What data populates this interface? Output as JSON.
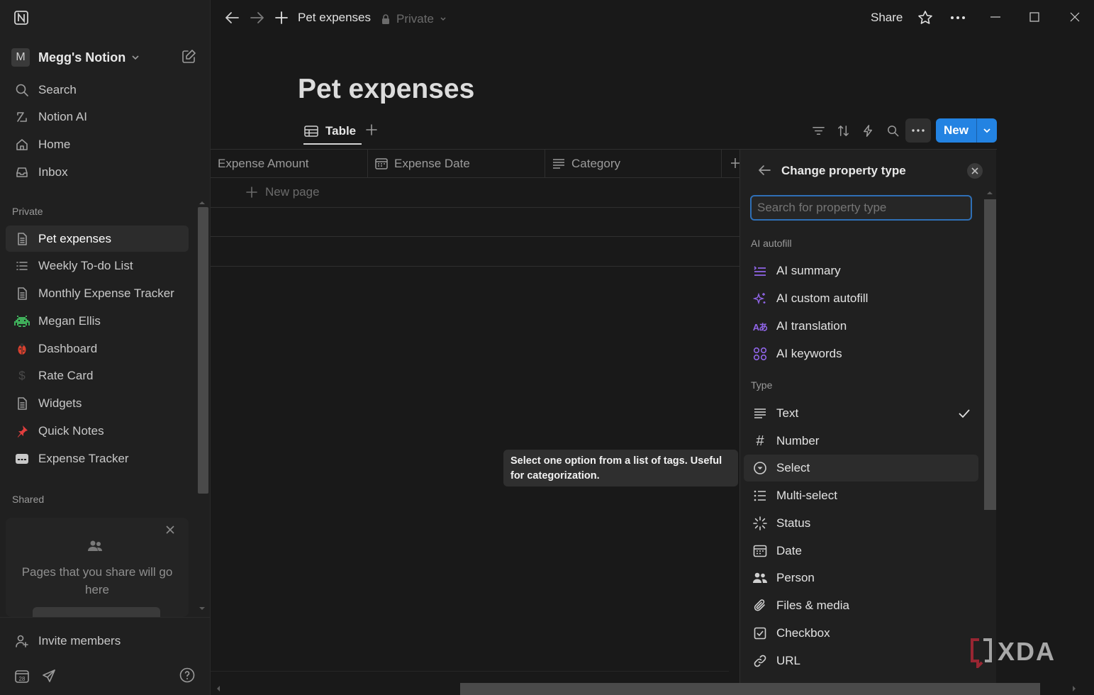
{
  "topbar": {
    "page_title": "Pet expenses",
    "privacy": "Private",
    "share": "Share"
  },
  "sidebar": {
    "workspace_initial": "M",
    "workspace_name": "Megg's Notion",
    "nav": [
      {
        "label": "Search",
        "icon": "search-icon"
      },
      {
        "label": "Notion AI",
        "icon": "notion-ai-icon"
      },
      {
        "label": "Home",
        "icon": "home-icon"
      },
      {
        "label": "Inbox",
        "icon": "inbox-icon"
      }
    ],
    "private_label": "Private",
    "pages": [
      {
        "label": "Pet expenses",
        "icon": "page-icon"
      },
      {
        "label": "Weekly To-do List",
        "icon": "list-icon"
      },
      {
        "label": "Monthly Expense Tracker",
        "icon": "page-icon"
      },
      {
        "label": "Megan Ellis",
        "icon": "space-invader-icon"
      },
      {
        "label": "Dashboard",
        "icon": "beetle-icon"
      },
      {
        "label": "Rate Card",
        "icon": "dollar-icon"
      },
      {
        "label": "Widgets",
        "icon": "page-icon"
      },
      {
        "label": "Quick Notes",
        "icon": "pin-icon"
      },
      {
        "label": "Expense Tracker",
        "icon": "card-icon"
      }
    ],
    "shared_label": "Shared",
    "shared_empty_text": "Pages that you share will go here",
    "invite_members": "Invite members"
  },
  "page": {
    "title": "Pet expenses",
    "view_tab": "Table",
    "new_button": "New"
  },
  "table": {
    "columns": [
      {
        "label": "Expense Amount"
      },
      {
        "label": "Expense Date"
      },
      {
        "label": "Category"
      }
    ],
    "new_page": "New page"
  },
  "tooltip": {
    "text": "Select one option from a list of tags. Useful for categorization."
  },
  "panel": {
    "title": "Change property type",
    "search_placeholder": "Search for property type",
    "ai_label": "AI autofill",
    "ai_options": [
      {
        "label": "AI summary",
        "icon": "ai-summary-icon"
      },
      {
        "label": "AI custom autofill",
        "icon": "sparkle-icon"
      },
      {
        "label": "AI translation",
        "icon": "translate-icon"
      },
      {
        "label": "AI keywords",
        "icon": "keywords-icon"
      }
    ],
    "type_label": "Type",
    "type_options": [
      {
        "label": "Text",
        "icon": "text-icon",
        "selected": true
      },
      {
        "label": "Number",
        "icon": "hash-icon"
      },
      {
        "label": "Select",
        "icon": "select-icon",
        "hovered": true
      },
      {
        "label": "Multi-select",
        "icon": "multi-select-icon"
      },
      {
        "label": "Status",
        "icon": "status-icon"
      },
      {
        "label": "Date",
        "icon": "calendar-icon"
      },
      {
        "label": "Person",
        "icon": "person-icon"
      },
      {
        "label": "Files & media",
        "icon": "paperclip-icon"
      },
      {
        "label": "Checkbox",
        "icon": "checkbox-icon"
      },
      {
        "label": "URL",
        "icon": "link-icon"
      }
    ]
  },
  "watermark": {
    "text": "XDA"
  },
  "colors": {
    "accent": "#2383e2",
    "background": "#191919",
    "sidebar": "#202020",
    "ai_purple": "#9065e8"
  }
}
